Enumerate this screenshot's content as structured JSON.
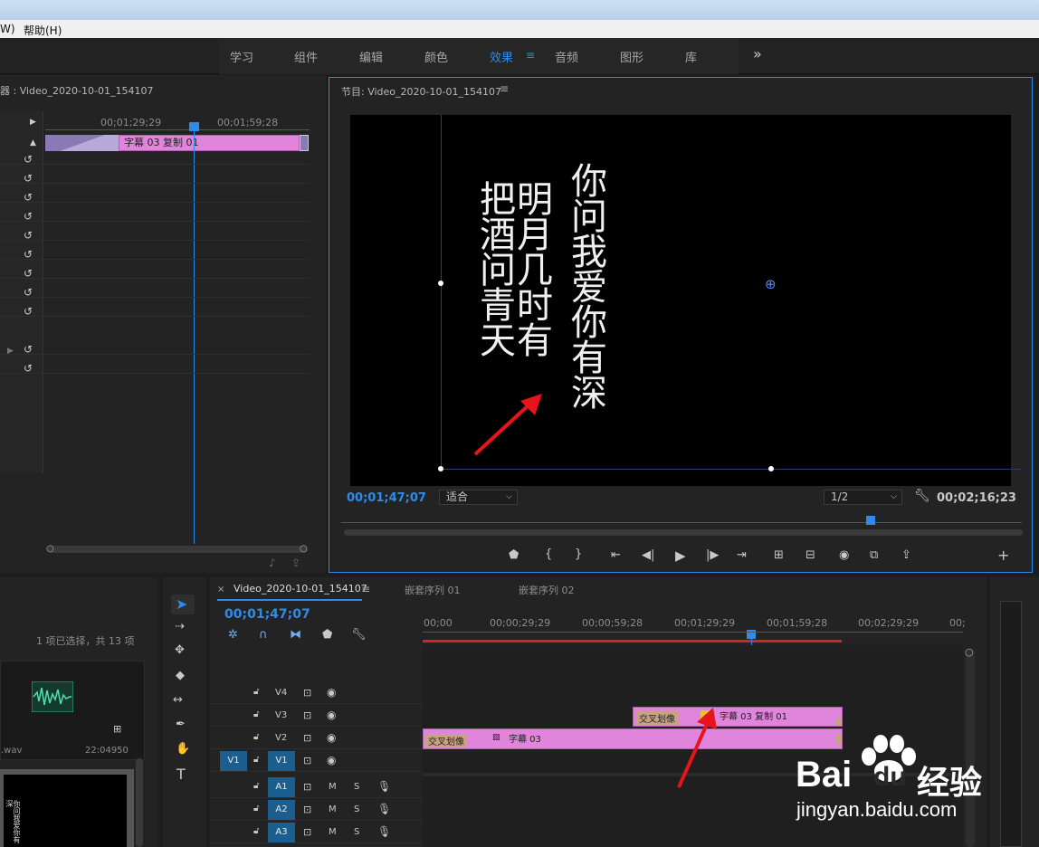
{
  "menu": {
    "item_w": "W)",
    "item_help": "帮助(H)"
  },
  "workspaces": [
    {
      "label": "学习"
    },
    {
      "label": "组件"
    },
    {
      "label": "编辑"
    },
    {
      "label": "颜色"
    },
    {
      "label": "效果"
    },
    {
      "label": "音频"
    },
    {
      "label": "图形"
    },
    {
      "label": "库"
    }
  ],
  "workspace_more": "»",
  "source_panel": {
    "title": "器 : Video_2020-10-01_154107",
    "tc_left": "00;01;29;29",
    "tc_right": "00;01;59;28",
    "clip_label": "字幕 03  复制 01"
  },
  "program": {
    "title": "节目: Video_2020-10-01_154107",
    "current_tc": "00;01;47;07",
    "fit_label": "适合",
    "resolution": "1/2",
    "duration_tc": "00;02;16;23",
    "poem_col1": "你问我爱你有深",
    "poem_col2": "明月几时有",
    "poem_col3": "把酒问青天"
  },
  "project": {
    "selection": "1 项已选择，共 13 项",
    "file_suffix": ".wav",
    "duration": "22:04950",
    "thumb_text": "你问我爱你有深"
  },
  "timeline": {
    "close_x": "×",
    "seq_tab": "Video_2020-10-01_154107",
    "nested1": "嵌套序列 01",
    "nested2": "嵌套序列 02",
    "current_tc": "00;01;47;07",
    "ruler": [
      "00;00",
      "00;00;29;29",
      "00;00;59;28",
      "00;01;29;29",
      "00;01;59;28",
      "00;02;29;29",
      "00;"
    ],
    "video_tracks": [
      {
        "name": "V4"
      },
      {
        "name": "V3"
      },
      {
        "name": "V2"
      },
      {
        "name": "V1",
        "src": "V1"
      }
    ],
    "audio_tracks": [
      {
        "name": "A1"
      },
      {
        "name": "A2"
      },
      {
        "name": "A3"
      }
    ],
    "mute": "M",
    "solo": "S",
    "clip_v3_fx": "交叉划像",
    "clip_v3_label": "字幕 03  复制 01",
    "clip_v2_fx": "交叉划像",
    "clip_v2_label": "字幕 03"
  },
  "watermark": {
    "brand": "Bai",
    "brand2": "du",
    "cn": "经验",
    "url": "jingyan.baidu.com"
  },
  "colors": {
    "accent": "#2d8ceb",
    "clip": "#e184dc",
    "track_sel": "#1c5f8f",
    "arrow": "#e8141c"
  }
}
